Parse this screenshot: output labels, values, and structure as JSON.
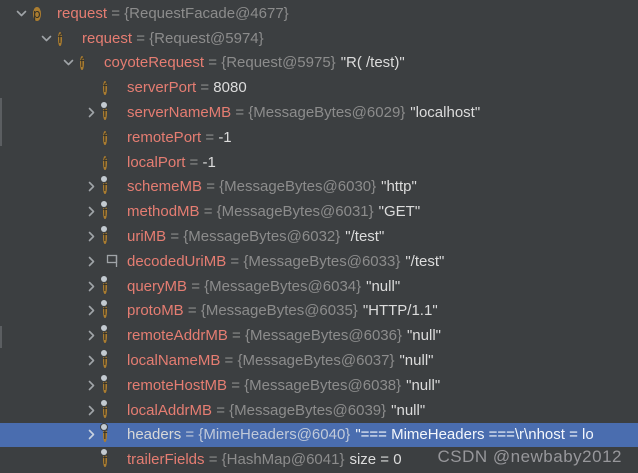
{
  "colors": {
    "background": "#3c3f41",
    "selection_blue": "#4a6daf",
    "field_name_pink": "#e57d72",
    "reference_gray": "#8c8c8c",
    "value_white": "#dcdcdc",
    "icon_gold": "#ab7d30",
    "chevron_gray": "#a0a4a8"
  },
  "watermark": "CSDN @newbaby2012",
  "tree": {
    "rows": [
      {
        "level": 0,
        "expand": "expanded",
        "icon": "parameter",
        "name": "request",
        "eq": " = ",
        "ref": "{RequestFacade@4677}",
        "value": "",
        "selected": false
      },
      {
        "level": 1,
        "expand": "expanded",
        "icon": "field",
        "name": "request",
        "eq": " = ",
        "ref": "{Request@5974}",
        "value": "",
        "selected": false
      },
      {
        "level": 2,
        "expand": "expanded",
        "icon": "field",
        "name": "coyoteRequest",
        "eq": " = ",
        "ref": "{Request@5975}",
        "value": "\"R( /test)\"",
        "selected": false
      },
      {
        "level": 3,
        "expand": "none",
        "icon": "field",
        "name": "serverPort",
        "eq": " = ",
        "ref": "",
        "value": "8080",
        "selected": false
      },
      {
        "level": 3,
        "expand": "collapsed",
        "icon": "field-dot",
        "name": "serverNameMB",
        "eq": " = ",
        "ref": "{MessageBytes@6029}",
        "value": "\"localhost\"",
        "selected": false
      },
      {
        "level": 3,
        "expand": "none",
        "icon": "field",
        "name": "remotePort",
        "eq": " = ",
        "ref": "",
        "value": "-1",
        "selected": false
      },
      {
        "level": 3,
        "expand": "none",
        "icon": "field",
        "name": "localPort",
        "eq": " = ",
        "ref": "",
        "value": "-1",
        "selected": false
      },
      {
        "level": 3,
        "expand": "collapsed",
        "icon": "field-dot",
        "name": "schemeMB",
        "eq": " = ",
        "ref": "{MessageBytes@6030}",
        "value": "\"http\"",
        "selected": false
      },
      {
        "level": 3,
        "expand": "collapsed",
        "icon": "field-dot",
        "name": "methodMB",
        "eq": " = ",
        "ref": "{MessageBytes@6031}",
        "value": "\"GET\"",
        "selected": false
      },
      {
        "level": 3,
        "expand": "collapsed",
        "icon": "field-dot",
        "name": "uriMB",
        "eq": " = ",
        "ref": "{MessageBytes@6032}",
        "value": "\"/test\"",
        "selected": false
      },
      {
        "level": 3,
        "expand": "collapsed",
        "icon": "flag",
        "name": "decodedUriMB",
        "eq": " = ",
        "ref": "{MessageBytes@6033}",
        "value": "\"/test\"",
        "selected": false
      },
      {
        "level": 3,
        "expand": "collapsed",
        "icon": "field-dot",
        "name": "queryMB",
        "eq": " = ",
        "ref": "{MessageBytes@6034}",
        "value": "\"null\"",
        "selected": false
      },
      {
        "level": 3,
        "expand": "collapsed",
        "icon": "field-dot",
        "name": "protoMB",
        "eq": " = ",
        "ref": "{MessageBytes@6035}",
        "value": "\"HTTP/1.1\"",
        "selected": false
      },
      {
        "level": 3,
        "expand": "collapsed",
        "icon": "field-dot",
        "name": "remoteAddrMB",
        "eq": " = ",
        "ref": "{MessageBytes@6036}",
        "value": "\"null\"",
        "selected": false
      },
      {
        "level": 3,
        "expand": "collapsed",
        "icon": "field-dot",
        "name": "localNameMB",
        "eq": " = ",
        "ref": "{MessageBytes@6037}",
        "value": "\"null\"",
        "selected": false
      },
      {
        "level": 3,
        "expand": "collapsed",
        "icon": "field-dot",
        "name": "remoteHostMB",
        "eq": " = ",
        "ref": "{MessageBytes@6038}",
        "value": "\"null\"",
        "selected": false
      },
      {
        "level": 3,
        "expand": "collapsed",
        "icon": "field-dot",
        "name": "localAddrMB",
        "eq": " = ",
        "ref": "{MessageBytes@6039}",
        "value": "\"null\"",
        "selected": false
      },
      {
        "level": 3,
        "expand": "collapsed",
        "icon": "field-dot",
        "name": "headers",
        "eq": " = ",
        "ref": "{MimeHeaders@6040}",
        "value": "\"=== MimeHeaders ===\\r\\nhost = lo",
        "selected": true
      },
      {
        "level": 3,
        "expand": "none",
        "icon": "field-dot",
        "name": "trailerFields",
        "eq": " = ",
        "ref": "{HashMap@6041}",
        "value": "size = 0",
        "selected": false
      }
    ]
  }
}
